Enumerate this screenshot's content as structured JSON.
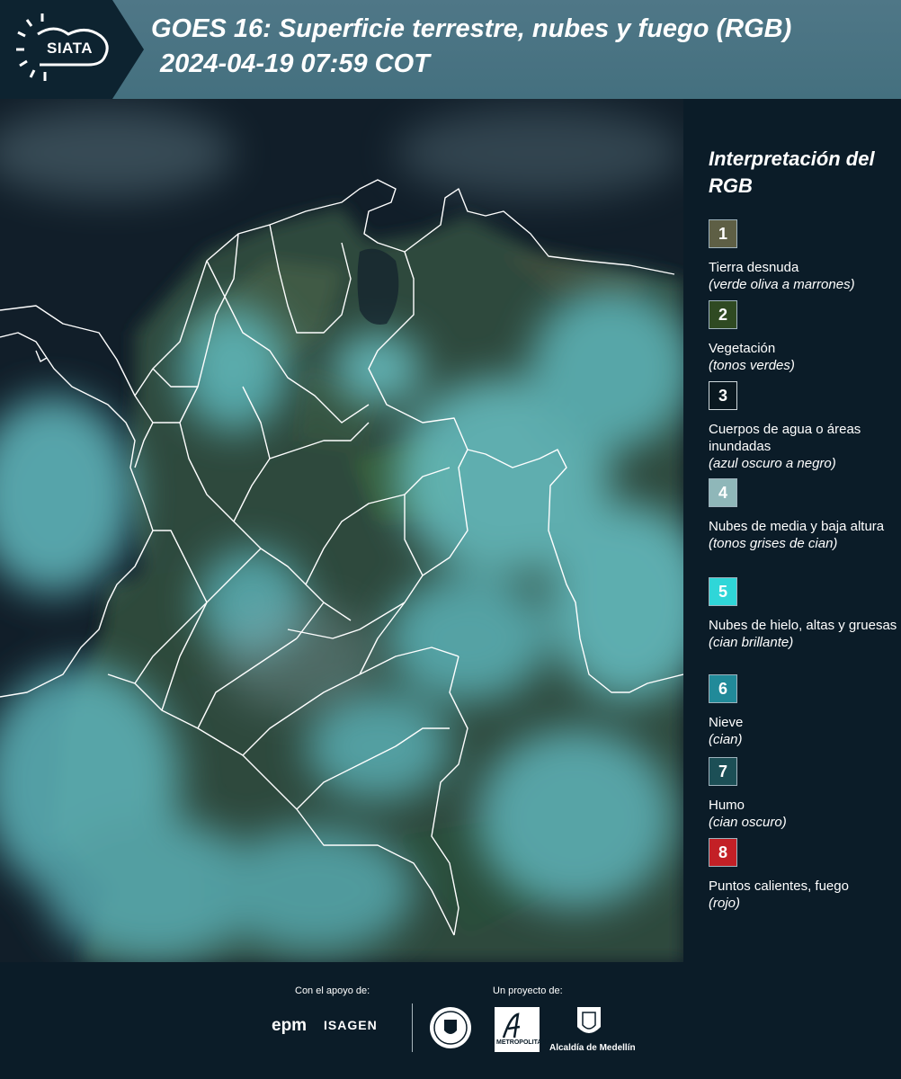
{
  "header": {
    "logo_text": "SIATA",
    "title": "GOES 16: Superficie terrestre, nubes y fuego (RGB)",
    "subtitle": "2024-04-19 07:59 COT"
  },
  "map": {
    "background_color": "#0e1b26",
    "cloud_color": "#5fb9bf",
    "land_color": "#3b5a49",
    "border_color": "#ffffff"
  },
  "legend": {
    "title": "Interpretación del RGB",
    "items": [
      {
        "number": "1",
        "label": "Tierra desnuda",
        "note": "(verde oliva a marrones)",
        "color": "#5e5f45"
      },
      {
        "number": "2",
        "label": "Vegetación",
        "note": "(tonos verdes)",
        "color": "#2f4a22"
      },
      {
        "number": "3",
        "label": "Cuerpos de agua o áreas inundadas",
        "note": "(azul oscuro a negro)",
        "color": "#0a1820"
      },
      {
        "number": "4",
        "label": "Nubes de media y baja altura",
        "note": "(tonos grises de cian)",
        "color": "#8fb7b9"
      },
      {
        "number": "5",
        "label": "Nubes de hielo, altas y gruesas",
        "note": "(cian brillante)",
        "color": "#2fd6d8"
      },
      {
        "number": "6",
        "label": "Nieve",
        "note": "(cian)",
        "color": "#218a99"
      },
      {
        "number": "7",
        "label": "Humo",
        "note": "(cian oscuro)",
        "color": "#1c4f56"
      },
      {
        "number": "8",
        "label": "Puntos calientes, fuego",
        "note": "(rojo)",
        "color": "#c32026"
      }
    ]
  },
  "footer": {
    "support_label": "Con el apoyo de:",
    "project_label": "Un proyecto de:",
    "epm": "epm",
    "isagen": "ISAGEN",
    "area_text": "METROPOLITANA",
    "alcaldia": "Alcaldía de Medellín"
  }
}
